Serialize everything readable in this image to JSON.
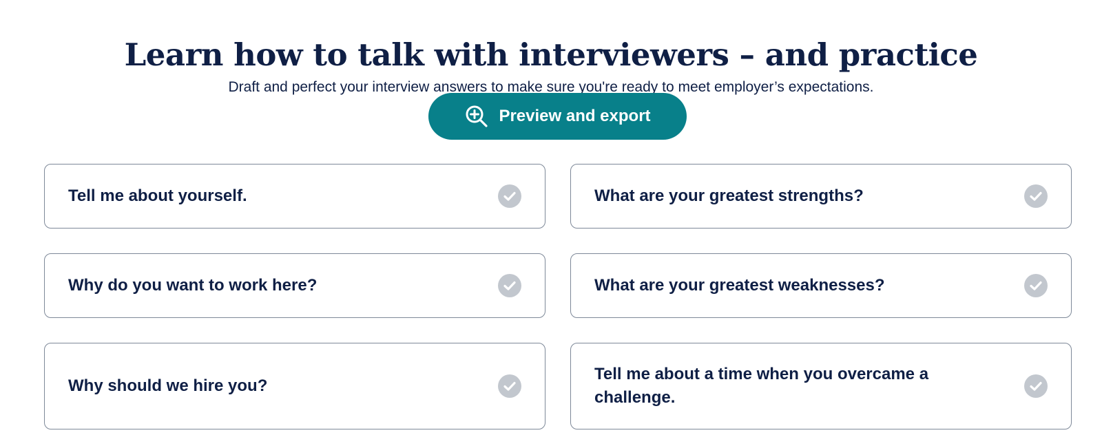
{
  "header": {
    "title": "Learn how to talk with interviewers – and practice",
    "subtitle": "Draft and perfect your interview answers to make sure you're ready to meet employer’s expectations."
  },
  "preview_button": {
    "label": "Preview and export",
    "icon": "zoom-in-icon"
  },
  "questions": [
    {
      "label": "Tell me about yourself.",
      "status_icon": "check-circle-icon"
    },
    {
      "label": "What are your greatest strengths?",
      "status_icon": "check-circle-icon"
    },
    {
      "label": "Why do you want to work here?",
      "status_icon": "check-circle-icon"
    },
    {
      "label": "What are your greatest weaknesses?",
      "status_icon": "check-circle-icon"
    },
    {
      "label": "Why should we hire you?",
      "status_icon": "check-circle-icon"
    },
    {
      "label": "Tell me about a time when you overcame a challenge.",
      "status_icon": "check-circle-icon"
    }
  ],
  "colors": {
    "text": "#0f1f45",
    "accent": "#08808a",
    "card_border": "#7d8898",
    "check_inactive": "#c2c7ce"
  }
}
